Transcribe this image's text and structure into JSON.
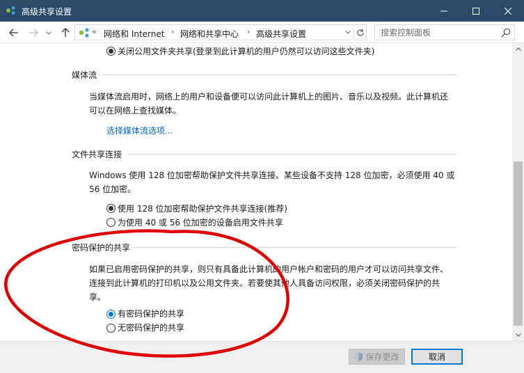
{
  "window": {
    "title": "高级共享设置",
    "controls": {
      "minimize": "minimize-icon",
      "maximize": "maximize-icon",
      "close": "close-icon"
    }
  },
  "nav": {
    "overflow": "«",
    "breadcrumbs": [
      "网络和 Internet",
      "网络和共享中心",
      "高级共享设置"
    ],
    "search_placeholder": "搜索控制面板"
  },
  "content": {
    "public_folder_option": "关闭公用文件夹共享(登录到此计算机的用户仍然可以访问这些文件夹)",
    "media": {
      "title": "媒体流",
      "desc_lines": [
        "当媒体流启用时，网络上的用户和设备便可以访问此计算机上的图片、音乐以及视频。此计算机还",
        "可以在网络上查找媒体。"
      ],
      "link": "选择媒体流选项..."
    },
    "file_sharing": {
      "title": "文件共享连接",
      "desc_lines": [
        "Windows 使用 128 位加密帮助保护文件共享连接。某些设备不支持 128 位加密，必须使用 40 或",
        "56 位加密。"
      ],
      "options": [
        {
          "label": "使用 128 位加密帮助保护文件共享连接(推荐)",
          "selected": true
        },
        {
          "label": "为使用 40 或 56 位加密的设备启用文件共享",
          "selected": false
        }
      ]
    },
    "password": {
      "title": "密码保护的共享",
      "desc_lines": [
        "如果已启用密码保护的共享，则只有具备此计算机的用户帐户和密码的用户才可以访问共享文件、",
        "连接到此计算机的打印机以及公用文件夹。若要使其他人具备访问权限，必须关闭密码保护的共",
        "享。"
      ],
      "options": [
        {
          "label": "有密码保护的共享",
          "selected": true
        },
        {
          "label": "无密码保护的共享",
          "selected": false
        }
      ]
    }
  },
  "footer": {
    "save_label": "保存更改",
    "cancel_label": "取消"
  },
  "colors": {
    "titlebar": "#2b4a6a",
    "link": "#0066cc",
    "annotation": "#e00000",
    "accent": "#0078d7"
  }
}
